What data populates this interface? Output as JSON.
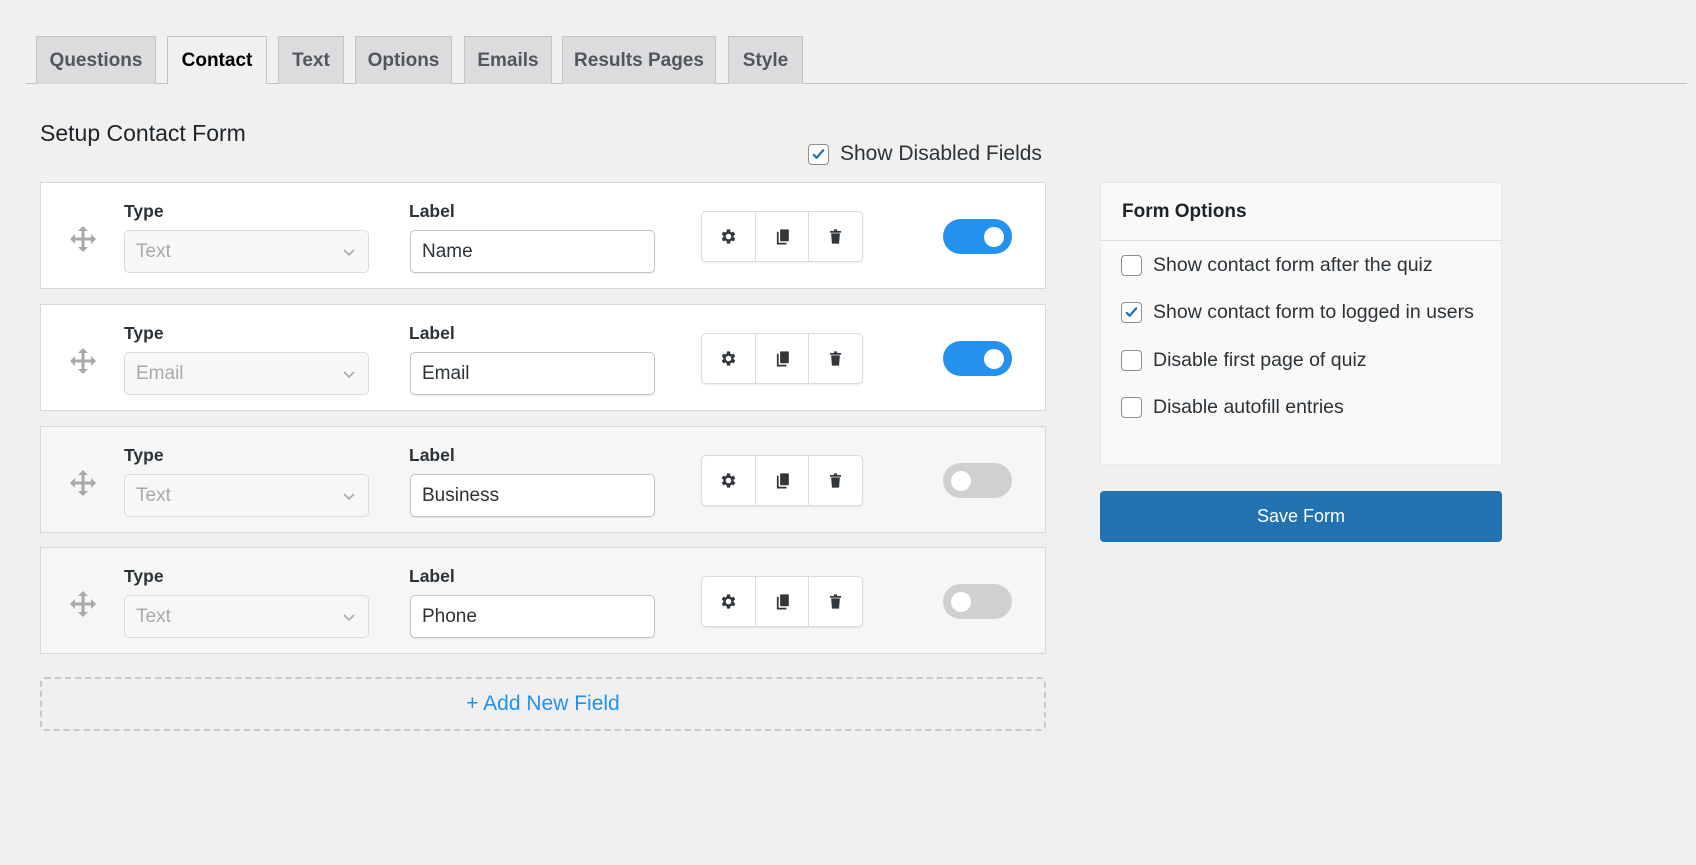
{
  "tabs": [
    {
      "label": "Questions",
      "active": false
    },
    {
      "label": "Contact",
      "active": true
    },
    {
      "label": "Text",
      "active": false
    },
    {
      "label": "Options",
      "active": false
    },
    {
      "label": "Emails",
      "active": false
    },
    {
      "label": "Results Pages",
      "active": false
    },
    {
      "label": "Style",
      "active": false
    }
  ],
  "page_title": "Setup Contact Form",
  "show_disabled": {
    "label": "Show Disabled Fields",
    "checked": true
  },
  "field_headers": {
    "type": "Type",
    "label": "Label"
  },
  "fields": [
    {
      "type": "Text",
      "label": "Name",
      "enabled": true
    },
    {
      "type": "Email",
      "label": "Email",
      "enabled": true
    },
    {
      "type": "Text",
      "label": "Business",
      "enabled": false
    },
    {
      "type": "Text",
      "label": "Phone",
      "enabled": false
    }
  ],
  "field_actions": [
    "gear-icon",
    "copy-icon",
    "trash-icon"
  ],
  "add_field_label": "+ Add New Field",
  "form_options": {
    "title": "Form Options",
    "items": [
      {
        "label": "Show contact form after the quiz",
        "checked": false
      },
      {
        "label": "Show contact form to logged in users",
        "checked": true
      },
      {
        "label": "Disable first page of quiz",
        "checked": false
      },
      {
        "label": "Disable autofill entries",
        "checked": false
      }
    ]
  },
  "save_label": "Save Form",
  "colors": {
    "accent": "#2271b1",
    "toggle_on": "#2491ee",
    "toggle_off": "#d0d0d0",
    "link": "#2491ee"
  }
}
